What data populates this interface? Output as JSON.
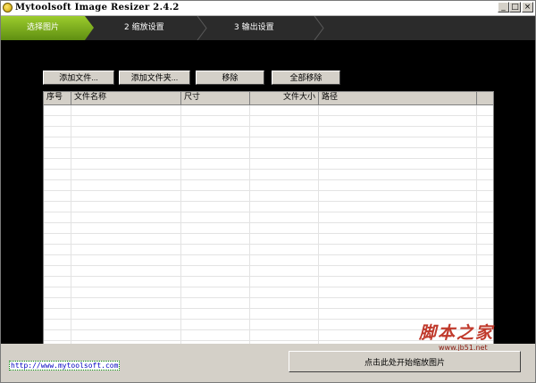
{
  "window": {
    "title": "Mytoolsoft Image Resizer 2.4.2",
    "controls": [
      "_",
      "□",
      "×"
    ]
  },
  "steps": [
    {
      "label": "选择图片",
      "active": true
    },
    {
      "label": "2  缩放设置",
      "active": false
    },
    {
      "label": "3  输出设置",
      "active": false
    }
  ],
  "toolbar": {
    "add_files": "添加文件...",
    "add_folder": "添加文件夹...",
    "remove": "移除",
    "remove_all": "全部移除"
  },
  "table": {
    "columns": [
      "序号",
      "文件名称",
      "尺寸",
      "文件大小",
      "路径"
    ],
    "rows": []
  },
  "footer": {
    "link": "http://www.mytoolsoft.com",
    "start_button": "点击此处开始缩放图片"
  },
  "watermark": {
    "big": "脚本之家",
    "small": "www.jb51.net"
  },
  "colors": {
    "active_step": "#7fb51f",
    "step_bar": "#2b2b2b",
    "content_bg": "#000000",
    "link": "#0000c0"
  }
}
